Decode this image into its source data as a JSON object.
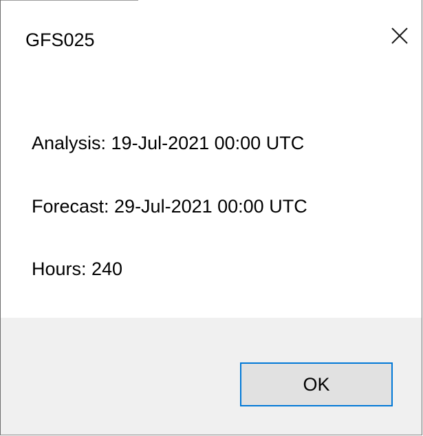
{
  "dialog": {
    "title": "GFS025",
    "close_icon": "close-icon",
    "lines": [
      "Analysis: 19-Jul-2021 00:00 UTC",
      "Forecast: 29-Jul-2021 00:00 UTC",
      "Hours: 240"
    ],
    "ok_label": "OK"
  },
  "colors": {
    "button_border": "#0078d7",
    "button_bg": "#e1e1e1",
    "footer_bg": "#f0f0f0"
  }
}
